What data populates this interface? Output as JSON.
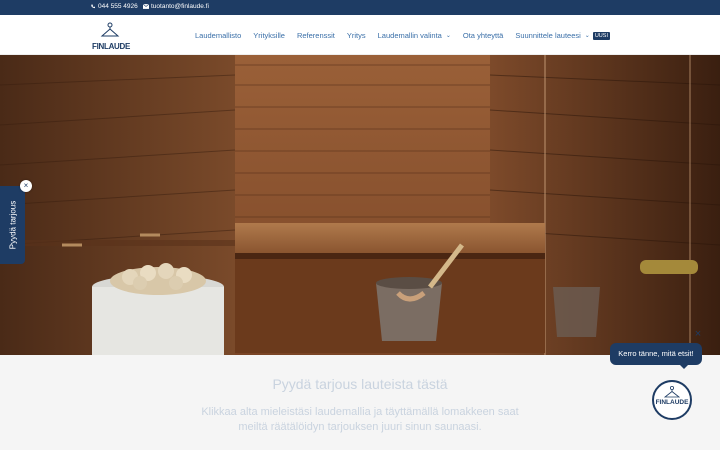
{
  "topbar": {
    "phone": "044 555 4926",
    "email": "tuotanto@finlaude.fi"
  },
  "logo": {
    "text": "FINLAUDE"
  },
  "nav": {
    "items": [
      {
        "label": "Laudemallisto"
      },
      {
        "label": "Yrityksille"
      },
      {
        "label": "Referenssit"
      },
      {
        "label": "Yritys"
      },
      {
        "label": "Laudemallin valinta",
        "dropdown": true
      },
      {
        "label": "Ota yhteyttä"
      },
      {
        "label": "Suunnittele lauteesi",
        "dropdown": true,
        "badge": "UUSI"
      }
    ]
  },
  "hero": {
    "image": "sauna-interior"
  },
  "section": {
    "title": "Pyydä tarjous lauteista tästä",
    "description": "Klikkaa alta mieleistäsi laudemallia ja täyttämällä lomakkeen saat meiltä räätälöidyn tarjouksen juuri sinun saunaasi."
  },
  "sidetab": {
    "label": "Pyydä tarjous",
    "close": "×"
  },
  "chat": {
    "bubble": "Kerro tänne, mitä etsit!",
    "avatar_text": "FINLAUDE",
    "close": "×"
  },
  "colors": {
    "brand": "#1e3c64",
    "nav": "#3a6fa8",
    "wood": "#8a5230"
  }
}
